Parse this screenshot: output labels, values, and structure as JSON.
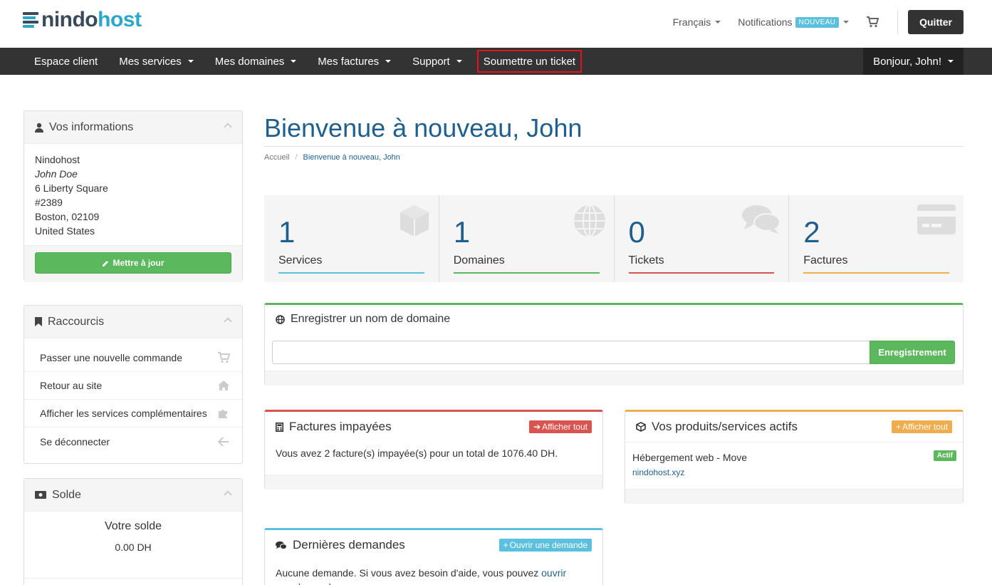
{
  "brand": {
    "logo_part1": "nindo",
    "logo_part2": "host",
    "colors": {
      "dark": "#3a4a5a",
      "accent": "#2aa7c9"
    }
  },
  "topbar": {
    "language": "Français",
    "notifications": "Notifications",
    "notifications_badge": "NOUVEAU",
    "cart_icon": "shopping-cart-icon",
    "quit": "Quitter"
  },
  "nav": {
    "items": [
      {
        "label": "Espace client",
        "dropdown": false
      },
      {
        "label": "Mes services",
        "dropdown": true
      },
      {
        "label": "Mes domaines",
        "dropdown": true
      },
      {
        "label": "Mes factures",
        "dropdown": true
      },
      {
        "label": "Support",
        "dropdown": true
      },
      {
        "label": "Soumettre un ticket",
        "dropdown": false,
        "highlighted": true
      }
    ],
    "user": "Bonjour, John!"
  },
  "sidebar": {
    "info": {
      "title": "Vos informations",
      "company": "Nindohost",
      "name": "John Doe",
      "address1": "6 Liberty Square",
      "address2": "#2389",
      "city": "Boston, 02109",
      "country": "United States",
      "update_button": "Mettre à jour"
    },
    "shortcuts": {
      "title": "Raccourcis",
      "items": [
        {
          "label": "Passer une nouvelle commande",
          "icon": "shopping-cart-icon"
        },
        {
          "label": "Retour au site",
          "icon": "home-icon"
        },
        {
          "label": "Afficher les services complémentaires",
          "icon": "puzzle-icon"
        },
        {
          "label": "Se déconnecter",
          "icon": "arrow-left-icon"
        }
      ]
    },
    "balance": {
      "title": "Solde",
      "label": "Votre solde",
      "amount": "0.00 DH"
    }
  },
  "main": {
    "title": "Bienvenue à nouveau, John",
    "breadcrumb": {
      "home": "Accueil",
      "current": "Bienvenue à nouveau, John"
    },
    "stats": [
      {
        "value": "1",
        "label": "Services",
        "color": "#5bc0de",
        "icon": "cube-icon"
      },
      {
        "value": "1",
        "label": "Domaines",
        "color": "#5cb85c",
        "icon": "globe-icon"
      },
      {
        "value": "0",
        "label": "Tickets",
        "color": "#d9534f",
        "icon": "comments-icon"
      },
      {
        "value": "2",
        "label": "Factures",
        "color": "#f0ad4e",
        "icon": "credit-card-icon"
      }
    ],
    "domain_register": {
      "title": "Enregistrer un nom de domaine",
      "input_value": "",
      "button": "Enregistrement",
      "accent": "#5cb85c"
    },
    "unpaid": {
      "title": "Factures impayées",
      "button": "Afficher tout",
      "text": "Vous avez 2 facture(s) impayée(s) pour un total de 1076.40 DH.",
      "accent": "#d9534f"
    },
    "products": {
      "title": "Vos produits/services actifs",
      "button": "Afficher tout",
      "product_name": "Hébergement web - Move",
      "product_domain": "nindohost.xyz",
      "status": "Actif",
      "accent": "#f0ad4e"
    },
    "tickets": {
      "title": "Dernières demandes",
      "button": "Ouvrir une demande",
      "text": "Aucune demande. Si vous avez besoin d'aide, vous pouvez ",
      "link": "ouvrir une demande",
      "accent": "#5bc0de"
    }
  }
}
